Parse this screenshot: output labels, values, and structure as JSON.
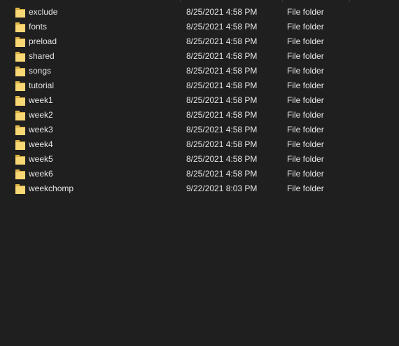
{
  "files": [
    {
      "name": "exclude",
      "date_modified": "8/25/2021 4:58 PM",
      "type": "File folder",
      "icon": "folder-icon"
    },
    {
      "name": "fonts",
      "date_modified": "8/25/2021 4:58 PM",
      "type": "File folder",
      "icon": "folder-icon"
    },
    {
      "name": "preload",
      "date_modified": "8/25/2021 4:58 PM",
      "type": "File folder",
      "icon": "folder-icon"
    },
    {
      "name": "shared",
      "date_modified": "8/25/2021 4:58 PM",
      "type": "File folder",
      "icon": "folder-icon"
    },
    {
      "name": "songs",
      "date_modified": "8/25/2021 4:58 PM",
      "type": "File folder",
      "icon": "folder-icon"
    },
    {
      "name": "tutorial",
      "date_modified": "8/25/2021 4:58 PM",
      "type": "File folder",
      "icon": "folder-icon"
    },
    {
      "name": "week1",
      "date_modified": "8/25/2021 4:58 PM",
      "type": "File folder",
      "icon": "folder-icon"
    },
    {
      "name": "week2",
      "date_modified": "8/25/2021 4:58 PM",
      "type": "File folder",
      "icon": "folder-icon"
    },
    {
      "name": "week3",
      "date_modified": "8/25/2021 4:58 PM",
      "type": "File folder",
      "icon": "folder-icon"
    },
    {
      "name": "week4",
      "date_modified": "8/25/2021 4:58 PM",
      "type": "File folder",
      "icon": "folder-icon"
    },
    {
      "name": "week5",
      "date_modified": "8/25/2021 4:58 PM",
      "type": "File folder",
      "icon": "folder-icon"
    },
    {
      "name": "week6",
      "date_modified": "8/25/2021 4:58 PM",
      "type": "File folder",
      "icon": "folder-icon"
    },
    {
      "name": "weekchomp",
      "date_modified": "9/22/2021 8:03 PM",
      "type": "File folder",
      "icon": "folder-icon"
    }
  ],
  "colors": {
    "background": "#1f1f1f",
    "text": "#e6e6e6",
    "folder_body": "#f8d775",
    "folder_tab": "#e1b94a"
  }
}
